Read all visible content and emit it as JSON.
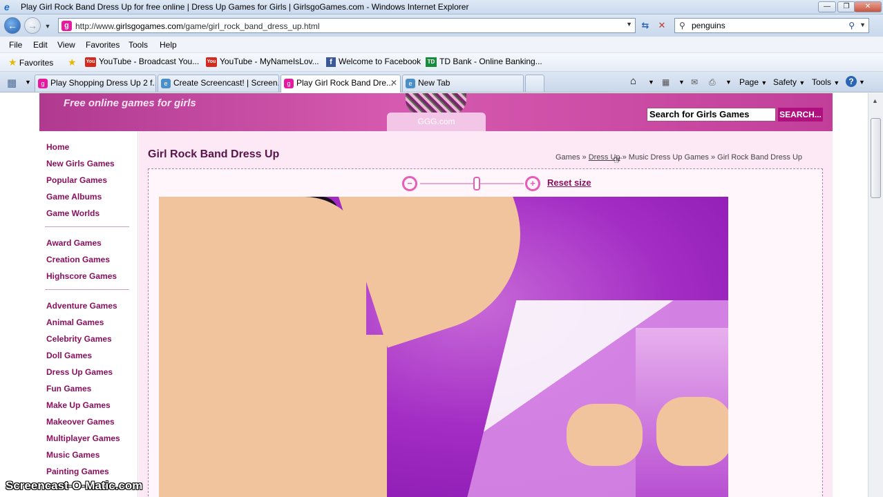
{
  "window": {
    "title": "Play Girl Rock Band Dress Up for free online | Dress Up Games for Girls | GirlsgoGames.com - Windows Internet Explorer"
  },
  "address_bar": {
    "url_prefix": "http://www.",
    "url_domain": "girlsgogames.com",
    "url_path": "/game/girl_rock_band_dress_up.html",
    "search_value": "penguins"
  },
  "menu": [
    "File",
    "Edit",
    "View",
    "Favorites",
    "Tools",
    "Help"
  ],
  "favorites_bar": {
    "label": "Favorites",
    "items": [
      {
        "label": "YouTube - Broadcast You..."
      },
      {
        "label": "YouTube - MyNameIsLov..."
      },
      {
        "label": "Welcome to Facebook"
      },
      {
        "label": "TD Bank - Online Banking..."
      }
    ]
  },
  "tabs": [
    {
      "label": "Play Shopping Dress Up 2 f..."
    },
    {
      "label": "Create Screencast! | Screen..."
    },
    {
      "label": "Play Girl Rock Band Dre..."
    },
    {
      "label": "New Tab"
    }
  ],
  "command_bar": {
    "page": "Page",
    "safety": "Safety",
    "tools": "Tools"
  },
  "site": {
    "tagline": "Free online games for girls",
    "logo_text": "GGG.com",
    "search_placeholder": "Search for Girls Games",
    "search_button": "SEARCH..."
  },
  "sidebar": {
    "group1": [
      "Home",
      "New Girls Games",
      "Popular Games",
      "Game Albums",
      "Game Worlds"
    ],
    "group2": [
      "Award Games",
      "Creation Games",
      "Highscore Games"
    ],
    "group3": [
      "Adventure Games",
      "Animal Games",
      "Celebrity Games",
      "Doll Games",
      "Dress Up Games",
      "Fun Games",
      "Make Up Games",
      "Makeover Games",
      "Multiplayer Games",
      "Music Games",
      "Painting Games"
    ]
  },
  "main": {
    "title": "Girl Rock Band Dress Up",
    "breadcrumb": {
      "games": "Games",
      "sep1": " » ",
      "dress_up": "Dress Up",
      "sep2": " » ",
      "music": "Music Dress Up Games",
      "sep3": " » ",
      "current": "Girl Rock Band Dress Up"
    },
    "reset_label": "Reset size"
  },
  "watermark": "Screencast-O-Matic.com",
  "colors": {
    "brand_pink": "#b0107e",
    "link_purple": "#8a0f5e",
    "header_magenta": "#c13f99"
  }
}
